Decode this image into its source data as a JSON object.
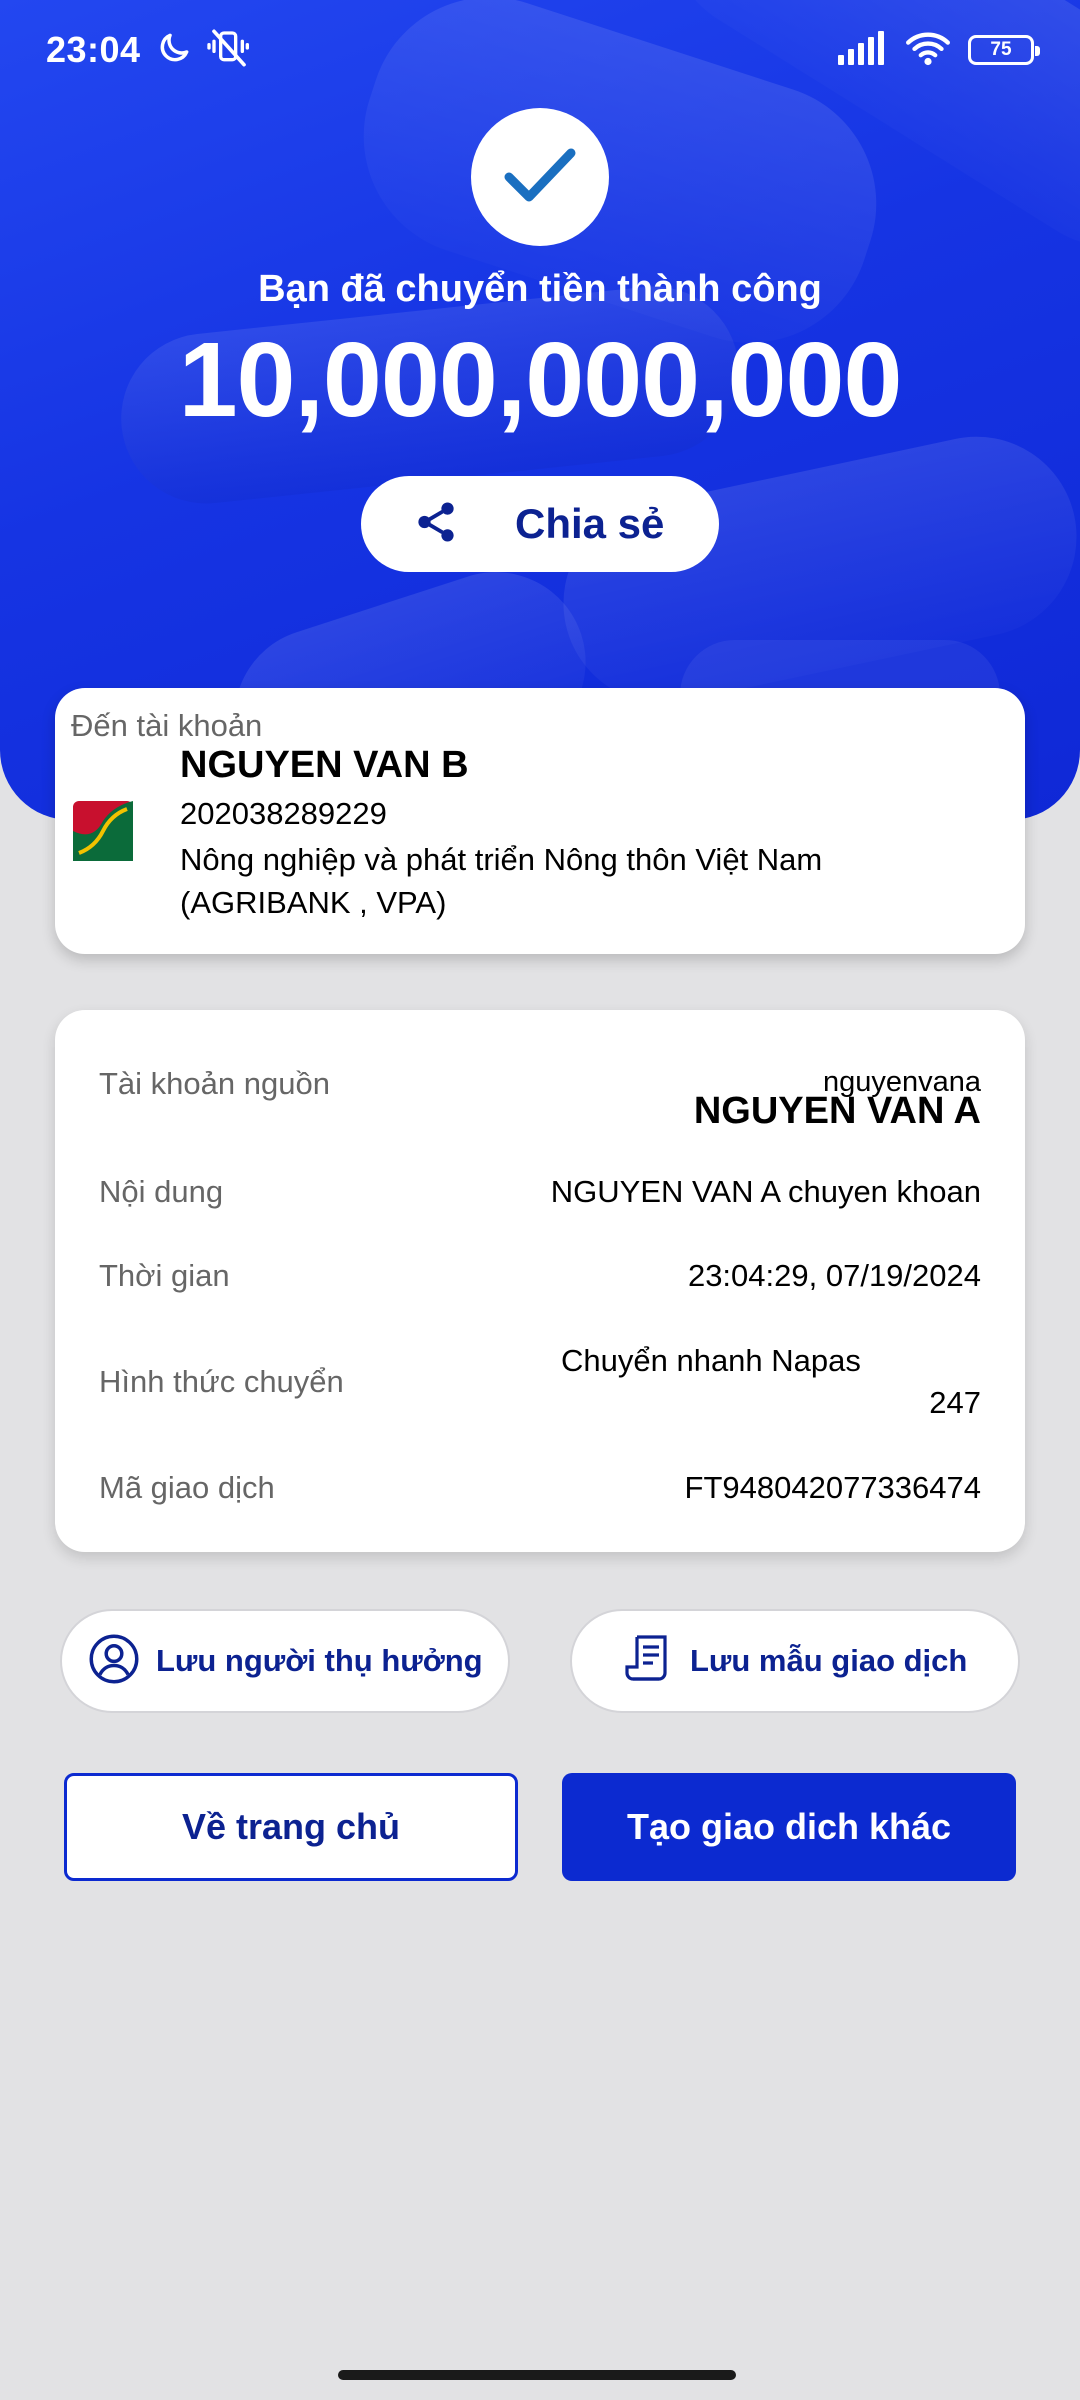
{
  "status_bar": {
    "time": "23:04",
    "battery": "75"
  },
  "success": {
    "message": "Bạn đã chuyển tiền thành công",
    "amount": "10,000,000,000",
    "share_label": "Chia sẻ"
  },
  "recipient": {
    "label": "Đến tài khoản",
    "name": "NGUYEN VAN B",
    "account_number": "202038289229",
    "bank": "Nông nghiệp và phát triển Nông thôn Việt Nam (AGRIBANK , VPA)"
  },
  "details": {
    "source_account": {
      "label": "Tài khoản nguồn",
      "username": "nguyenvana",
      "name": "NGUYEN VAN A"
    },
    "content": {
      "label": "Nội dung",
      "value": "NGUYEN VAN A chuyen khoan"
    },
    "time": {
      "label": "Thời gian",
      "value": "23:04:29, 07/19/2024"
    },
    "method": {
      "label": "Hình thức chuyển",
      "value_line1": "Chuyển nhanh Napas",
      "value_line2": "247"
    },
    "transaction_id": {
      "label": "Mã giao dịch",
      "value": "FT948042077336474"
    }
  },
  "actions": {
    "save_beneficiary": "Lưu người thụ hưởng",
    "save_template": "Lưu mẫu giao dịch",
    "home": "Về trang chủ",
    "new_transaction": "Tạo giao dich khác"
  },
  "colors": {
    "hero_blue": "#1634e3",
    "primary_dark": "#0c2291",
    "button_blue": "#0c2ad0",
    "background": "#e2e2e4"
  },
  "icons": [
    "moon-icon",
    "mute-icon",
    "signal-icon",
    "wifi-icon",
    "battery-icon",
    "checkmark-icon",
    "share-icon",
    "bank-logo-icon",
    "user-circle-icon",
    "receipt-icon"
  ]
}
